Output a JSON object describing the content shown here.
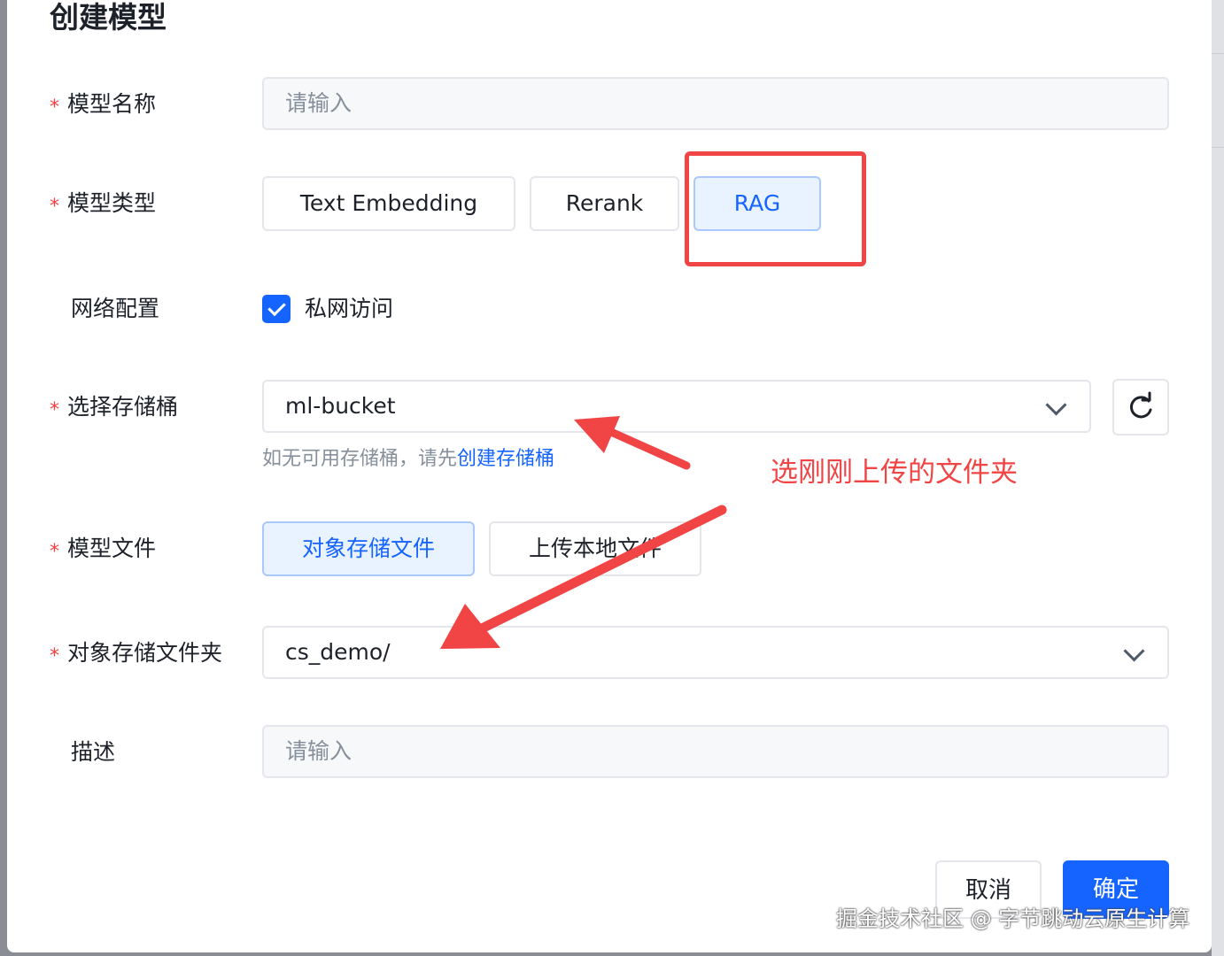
{
  "dialog": {
    "title": "创建模型",
    "required_mark": "*",
    "fields": {
      "model_name": {
        "label": "模型名称",
        "placeholder": "请输入"
      },
      "model_type": {
        "label": "模型类型",
        "options": [
          "Text Embedding",
          "Rerank",
          "RAG"
        ],
        "selected": "RAG"
      },
      "network": {
        "label": "网络配置",
        "checkbox_label": "私网访问",
        "checked": true
      },
      "bucket": {
        "label": "选择存储桶",
        "value": "ml-bucket",
        "hint": "如无可用存储桶，请先",
        "hint_link": "创建存储桶"
      },
      "model_file": {
        "label": "模型文件",
        "options": [
          "对象存储文件",
          "上传本地文件"
        ],
        "selected": "对象存储文件"
      },
      "folder": {
        "label": "对象存储文件夹",
        "value": "cs_demo/"
      },
      "description": {
        "label": "描述",
        "placeholder": "请输入"
      }
    },
    "buttons": {
      "cancel": "取消",
      "ok": "确定"
    }
  },
  "annotation": {
    "text": "选刚刚上传的文件夹",
    "color": "#f04445"
  },
  "watermark": "掘金技术社区 @ 字节跳动云原生计算",
  "colors": {
    "primary": "#1664ff",
    "required": "#f53f3f",
    "annotation": "#f04445"
  },
  "icons": {
    "select_arrow": "chevron-down-icon",
    "refresh": "refresh-icon",
    "checkbox": "check-icon"
  }
}
